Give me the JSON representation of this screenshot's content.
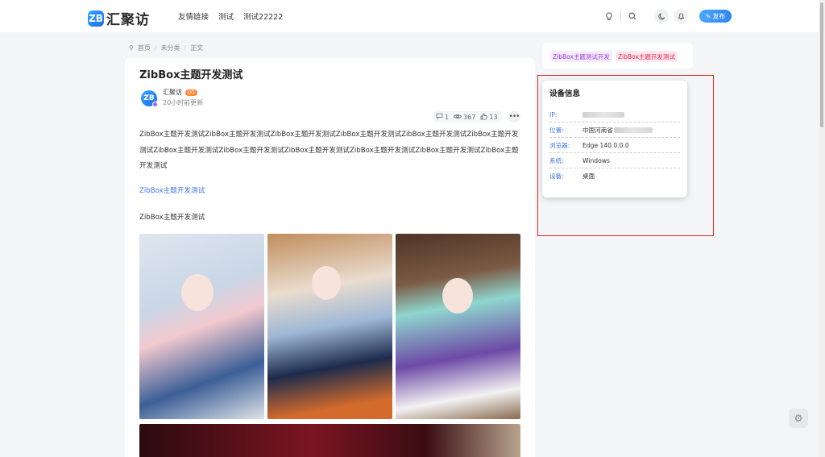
{
  "header": {
    "logo_mark": "ZB",
    "logo_text": "汇聚访",
    "nav": [
      "友情链接",
      "测试",
      "测试22222"
    ],
    "publish_label": "发布"
  },
  "breadcrumb": {
    "home": "首页",
    "category": "未分类",
    "current": "正文"
  },
  "article": {
    "title": "ZibBox主题开发测试",
    "author": "汇聚访",
    "author_level": "LV1",
    "updated": "20小时前更新",
    "stats": {
      "comments": "1",
      "views": "367",
      "likes": "13"
    },
    "paragraph1": "ZibBox主题开发测试ZibBox主题开发测试ZibBox主题开发测试ZibBox主题开发测试ZibBox主题开发测试ZibBox主题开发测试ZibBox主题开发测试ZibBox主题开发测试ZibBox主题开发测试ZibBox主题开发测试ZibBox主题开发测试ZibBox主题开发测试",
    "link": "ZibBox主题开发测试",
    "paragraph2": "ZibBox主题开发测试"
  },
  "sidebar": {
    "tags": [
      "ZibBox主题测试开发",
      "ZibBox主题开发测试"
    ],
    "device": {
      "title": "设备信息",
      "rows": [
        {
          "label": "IP:",
          "value": ""
        },
        {
          "label": "位置:",
          "value": "中国河南省"
        },
        {
          "label": "浏览器:",
          "value": "Edge 140.0.0.0"
        },
        {
          "label": "系统:",
          "value": "Windows"
        },
        {
          "label": "设备:",
          "value": "桌面"
        }
      ]
    }
  },
  "colors": {
    "accent": "#3c78e8",
    "highlight_box": "#e02727",
    "publish": "#2f86f3"
  },
  "icons": [
    "logo-icon",
    "bulb-icon",
    "search-icon",
    "moon-icon",
    "bell-icon",
    "pen-icon",
    "location-icon",
    "comment-icon",
    "eye-icon",
    "thumb-icon",
    "more-icon",
    "settings-icon"
  ]
}
